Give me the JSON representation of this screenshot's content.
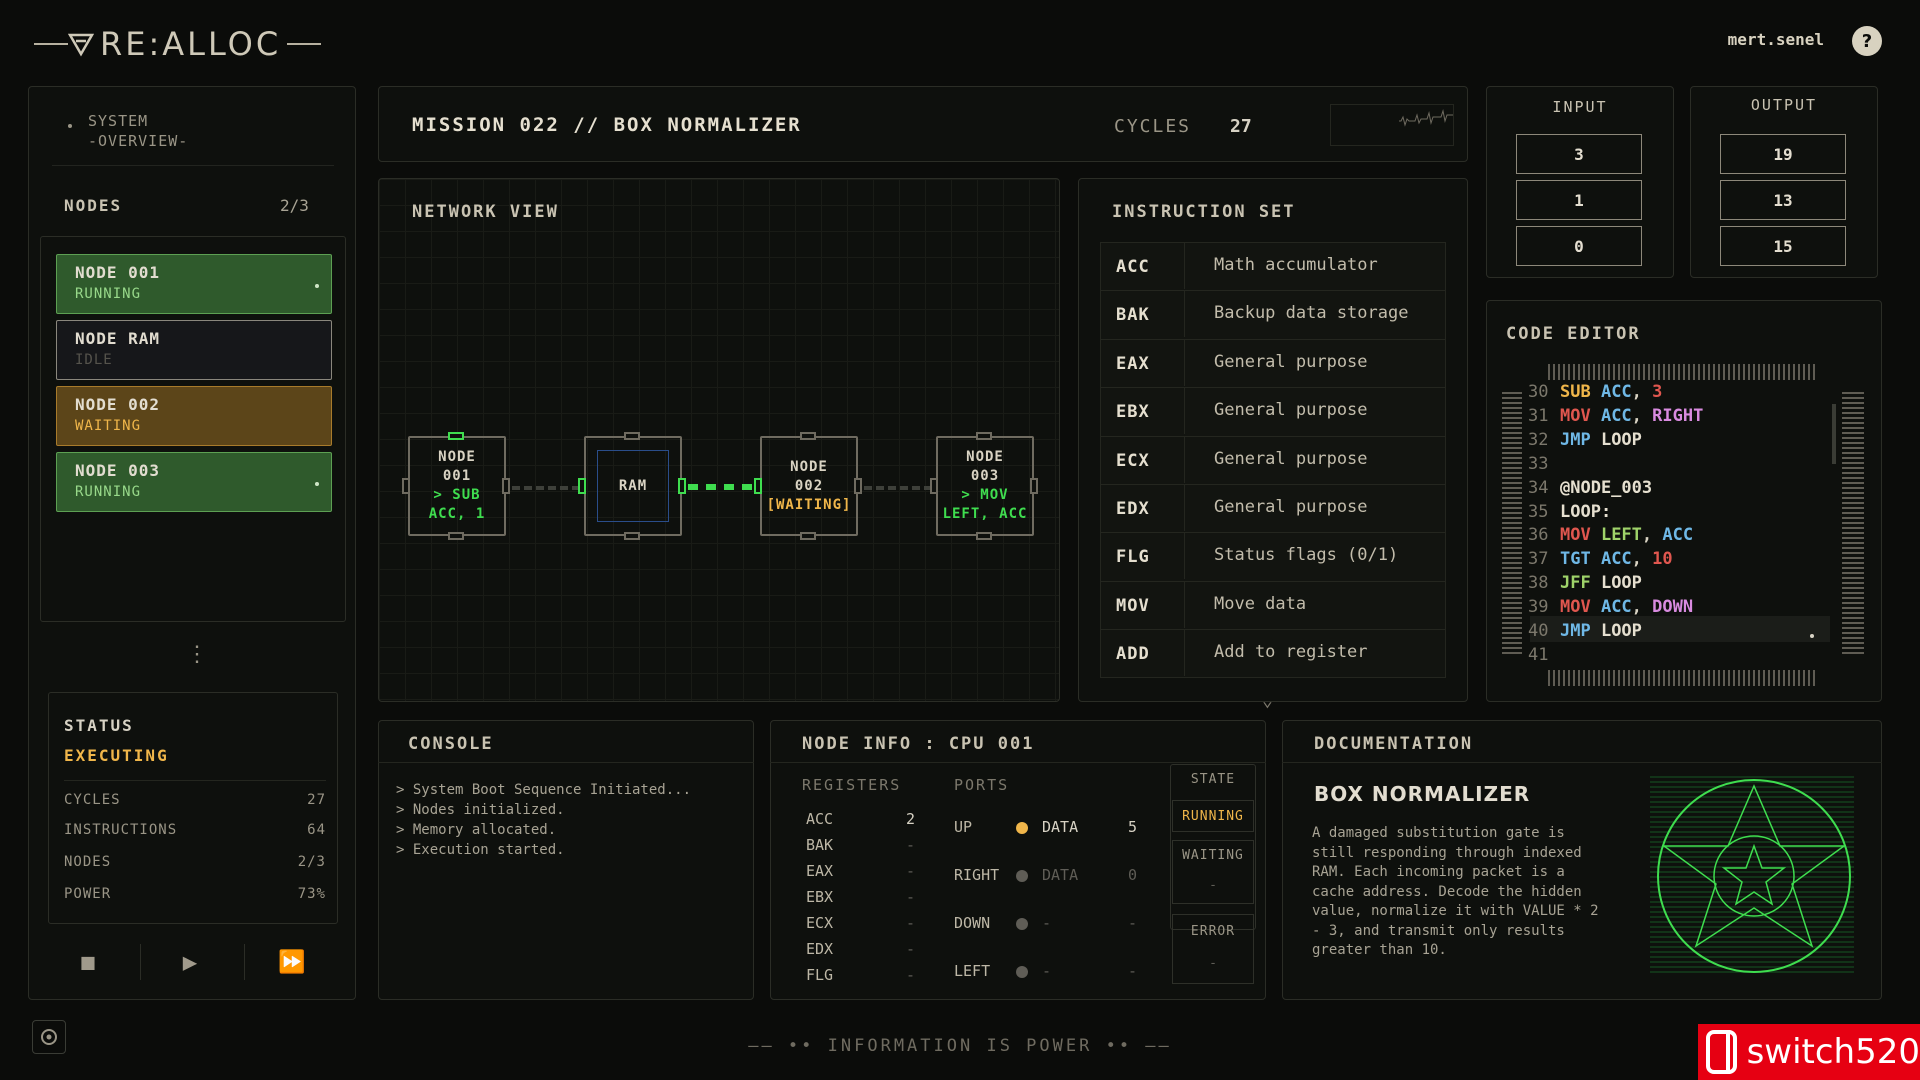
{
  "app": {
    "logo": "RE:ALLOC",
    "user": "mert.senel",
    "help": "?"
  },
  "sidebar": {
    "system_title": "SYSTEM",
    "system_sub": "-OVERVIEW-",
    "nodes_label": "NODES",
    "nodes_count": "2/3",
    "nodes": [
      {
        "name": "NODE 001",
        "state": "RUNNING"
      },
      {
        "name": "NODE RAM",
        "state": "IDLE"
      },
      {
        "name": "NODE 002",
        "state": "WAITING"
      },
      {
        "name": "NODE 003",
        "state": "RUNNING"
      }
    ],
    "more": "⋮"
  },
  "status": {
    "title": "STATUS",
    "value": "EXECUTING",
    "rows": [
      {
        "label": "CYCLES",
        "value": "27"
      },
      {
        "label": "INSTRUCTIONS",
        "value": "64"
      },
      {
        "label": "NODES",
        "value": "2/3"
      },
      {
        "label": "POWER",
        "value": "73%"
      }
    ]
  },
  "controls": {
    "stop": "■",
    "play": "▶",
    "fast": "⏩"
  },
  "header": {
    "mission": "MISSION 022 // BOX NORMALIZER",
    "cycles_label": "CYCLES",
    "cycles_value": "27"
  },
  "io": {
    "input_label": "INPUT",
    "input": [
      "3",
      "1",
      "0"
    ],
    "output_label": "OUTPUT",
    "output": [
      "19",
      "13",
      "15"
    ]
  },
  "network": {
    "title": "NETWORK VIEW",
    "nodes": [
      {
        "l1": "NODE",
        "l2": "001",
        "l3": "> SUB",
        "l4": "ACC, 1"
      },
      {
        "l1": "RAM"
      },
      {
        "l1": "NODE",
        "l2": "002",
        "l3": "[WAITING]"
      },
      {
        "l1": "NODE",
        "l2": "003",
        "l3": "> MOV",
        "l4": "LEFT, ACC"
      }
    ]
  },
  "instruction_set": {
    "title": "INSTRUCTION SET",
    "rows": [
      {
        "key": "ACC",
        "desc": "Math accumulator"
      },
      {
        "key": "BAK",
        "desc": "Backup data storage"
      },
      {
        "key": "EAX",
        "desc": "General purpose"
      },
      {
        "key": "EBX",
        "desc": "General purpose"
      },
      {
        "key": "ECX",
        "desc": "General purpose"
      },
      {
        "key": "EDX",
        "desc": "General purpose"
      },
      {
        "key": "FLG",
        "desc": "Status flags (0/1)"
      },
      {
        "key": "MOV",
        "desc": "Move data"
      },
      {
        "key": "ADD",
        "desc": "Add to register"
      }
    ]
  },
  "code_editor": {
    "title": "CODE EDITOR",
    "lines": [
      {
        "n": "30",
        "tokens": [
          [
            "SUB",
            "#f0b64a"
          ],
          [
            " ACC",
            "#6fb8e6"
          ],
          [
            ", ",
            "#d9d3c3"
          ],
          [
            "3",
            "#e0574f"
          ]
        ]
      },
      {
        "n": "31",
        "tokens": [
          [
            "MOV",
            "#e0574f"
          ],
          [
            " ACC",
            "#6fb8e6"
          ],
          [
            ", ",
            "#d9d3c3"
          ],
          [
            "RIGHT",
            "#d98be0"
          ]
        ]
      },
      {
        "n": "32",
        "tokens": [
          [
            "JMP",
            "#6fb8e6"
          ],
          [
            " LOOP",
            "#e6e0d0"
          ]
        ]
      },
      {
        "n": "33",
        "tokens": []
      },
      {
        "n": "34",
        "tokens": [
          [
            "@NODE_003",
            "#e6e0d0"
          ]
        ]
      },
      {
        "n": "35",
        "tokens": [
          [
            "LOOP:",
            "#e6e0d0"
          ]
        ]
      },
      {
        "n": "36",
        "tokens": [
          [
            "MOV",
            "#e0574f"
          ],
          [
            " LEFT",
            "#9fd36a"
          ],
          [
            ", ",
            "#d9d3c3"
          ],
          [
            "ACC",
            "#6fb8e6"
          ]
        ]
      },
      {
        "n": "37",
        "tokens": [
          [
            "TGT",
            "#6fb8e6"
          ],
          [
            " ACC",
            "#6fb8e6"
          ],
          [
            ", ",
            "#d9d3c3"
          ],
          [
            "10",
            "#e0574f"
          ]
        ]
      },
      {
        "n": "38",
        "tokens": [
          [
            "JFF",
            "#9fd36a"
          ],
          [
            " LOOP",
            "#e6e0d0"
          ]
        ]
      },
      {
        "n": "39",
        "tokens": [
          [
            "MOV",
            "#e0574f"
          ],
          [
            " ACC",
            "#6fb8e6"
          ],
          [
            ", ",
            "#d9d3c3"
          ],
          [
            "DOWN",
            "#d98be0"
          ]
        ]
      },
      {
        "n": "40",
        "tokens": [
          [
            "JMP",
            "#6fb8e6"
          ],
          [
            " LOOP",
            "#e6e0d0"
          ]
        ]
      },
      {
        "n": "41",
        "tokens": []
      }
    ]
  },
  "console": {
    "title": "CONSOLE",
    "lines": [
      "> System Boot Sequence Initiated...",
      "> Nodes initialized.",
      "> Memory allocated.",
      "> Execution started."
    ]
  },
  "node_info": {
    "title": "NODE INFO : CPU 001",
    "registers_label": "REGISTERS",
    "ports_label": "PORTS",
    "registers": [
      {
        "name": "ACC",
        "value": "2"
      },
      {
        "name": "BAK",
        "value": "-"
      },
      {
        "name": "EAX",
        "value": "-"
      },
      {
        "name": "EBX",
        "value": "-"
      },
      {
        "name": "ECX",
        "value": "-"
      },
      {
        "name": "EDX",
        "value": "-"
      },
      {
        "name": "FLG",
        "value": "-"
      }
    ],
    "ports": [
      {
        "name": "UP",
        "kind": "DATA",
        "value": "5",
        "color": "#f0b64a"
      },
      {
        "name": "RIGHT",
        "kind": "DATA",
        "value": "0",
        "color": "#5f5d56"
      },
      {
        "name": "DOWN",
        "kind": "-",
        "value": "-",
        "color": "#5f5d56"
      },
      {
        "name": "LEFT",
        "kind": "-",
        "value": "-",
        "color": "#5f5d56"
      }
    ],
    "state_label": "STATE",
    "state_running": "RUNNING",
    "state_waiting": "WAITING",
    "state_waiting_value": "-",
    "state_error": "ERROR",
    "state_error_value": "-"
  },
  "documentation": {
    "title": "DOCUMENTATION",
    "heading": "BOX NORMALIZER",
    "body": "A damaged substitution gate is still responding through indexed RAM. Each incoming packet is a cache address. Decode the hidden value, normalize it with VALUE * 2 - 3, and transmit only results greater than 10."
  },
  "footer": "INFORMATION IS POWER",
  "watermark": "switch520",
  "colors": {
    "running": "#5da053",
    "waiting": "#a87b2b",
    "accent_orange": "#f0b64a",
    "accent_green": "#3fdd4f"
  }
}
